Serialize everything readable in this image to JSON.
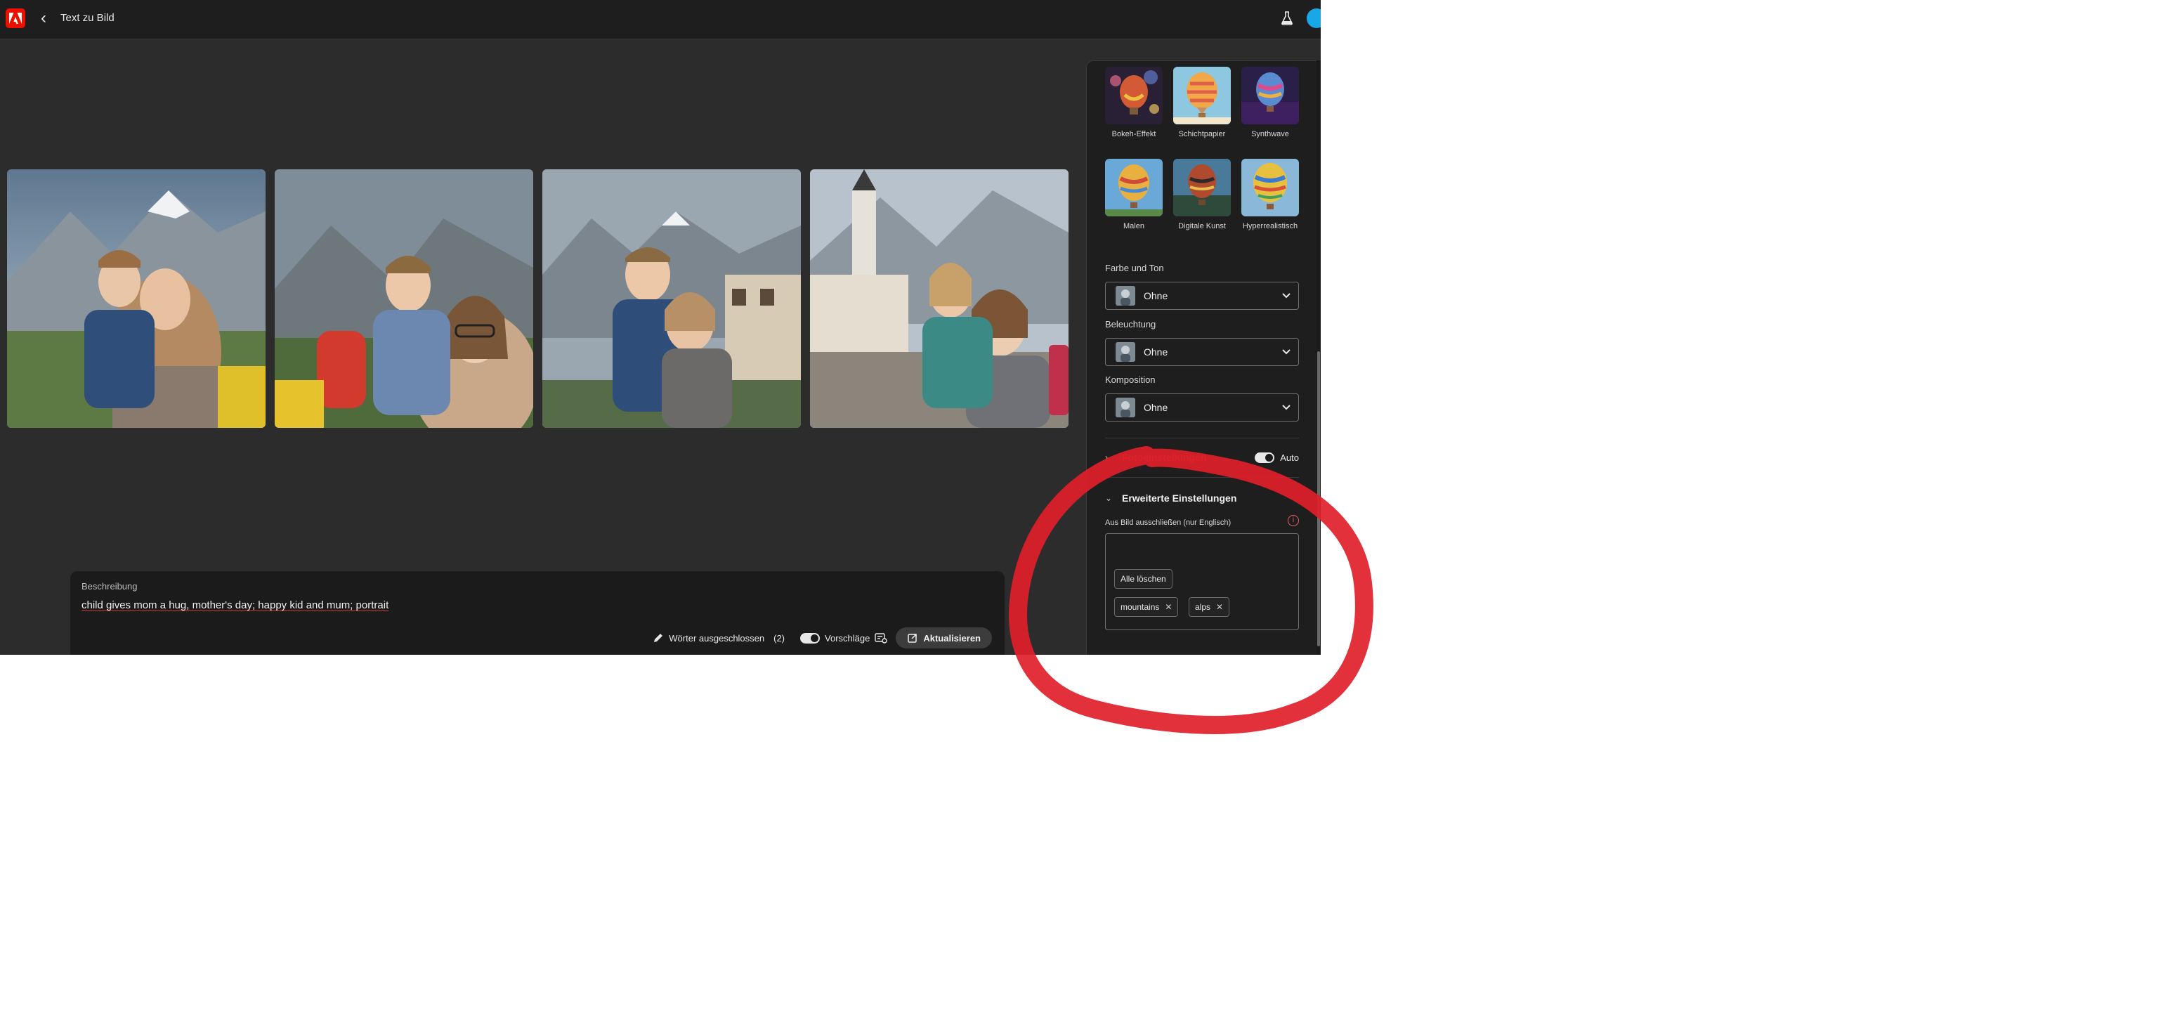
{
  "app": {
    "title": "Text zu Bild"
  },
  "styles": [
    {
      "label": "Bokeh-Effekt"
    },
    {
      "label": "Schichtpapier"
    },
    {
      "label": "Synthwave"
    },
    {
      "label": "Malen"
    },
    {
      "label": "Digitale Kunst"
    },
    {
      "label": "Hyperrealistisch"
    }
  ],
  "settings": {
    "color_tone": {
      "label": "Farbe und Ton",
      "value": "Ohne"
    },
    "lighting": {
      "label": "Beleuchtung",
      "value": "Ohne"
    },
    "composition": {
      "label": "Komposition",
      "value": "Ohne"
    },
    "photo_settings": {
      "label": "Fotoeinstellungen",
      "auto_label": "Auto"
    },
    "advanced": {
      "label": "Erweiterte Einstellungen",
      "exclude_label": "Aus Bild ausschließen (nur Englisch)",
      "clear_all": "Alle löschen",
      "excluded_words": [
        "mountains",
        "alps"
      ]
    }
  },
  "description": {
    "label": "Beschreibung",
    "text": "child gives mom a hug, mother's day; happy kid and mum; portrait",
    "excluded_words_label": "Wörter ausgeschlossen",
    "excluded_count": "(2)",
    "suggestions_label": "Vorschläge",
    "update_label": "Aktualisieren"
  },
  "colors": {
    "accent": "#eb1000",
    "annotation": "#e0202a",
    "panel_bg": "#1e1e1e",
    "canvas_bg": "#2c2c2c"
  }
}
